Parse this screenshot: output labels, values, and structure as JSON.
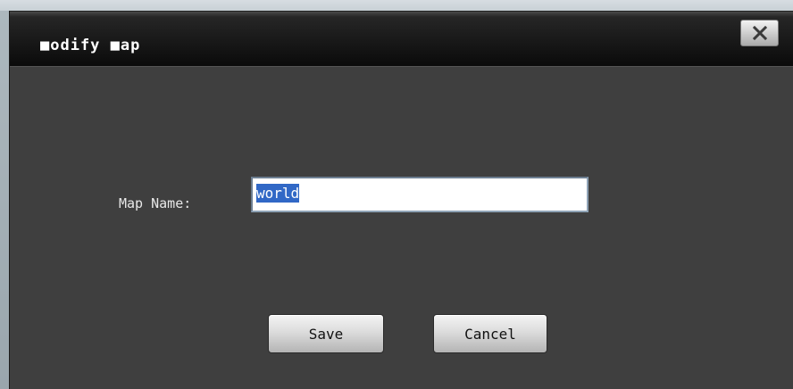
{
  "dialog": {
    "title": "■odify ■ap",
    "close_icon": "close-x-icon"
  },
  "form": {
    "map_name_label": "Map Name:",
    "map_name_value": "world"
  },
  "buttons": {
    "save_label": "Save",
    "cancel_label": "Cancel"
  },
  "colors": {
    "dialog_bg": "#3f3f3f",
    "titlebar_bg": "#0b0b0b",
    "selection": "#3168c6"
  }
}
